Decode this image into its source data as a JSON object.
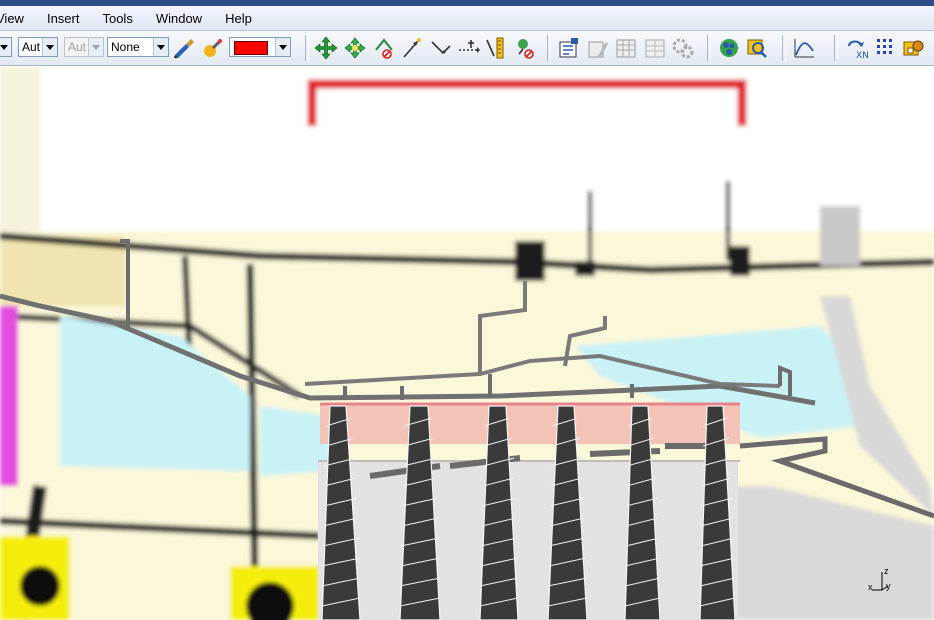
{
  "menubar": {
    "items": [
      {
        "label": "View",
        "name": "menu-view"
      },
      {
        "label": "Insert",
        "name": "menu-insert"
      },
      {
        "label": "Tools",
        "name": "menu-tools"
      },
      {
        "label": "Window",
        "name": "menu-window"
      },
      {
        "label": "Help",
        "name": "menu-help"
      }
    ]
  },
  "toolbar": {
    "combo_1": "Aut",
    "combo_2": "Aut",
    "combo_3": "None",
    "color_value": "#ff0000",
    "icons": [
      "paint-brush-icon",
      "highlight-brush-icon",
      "move-icon",
      "rotate-move-icon",
      "snap-point-icon",
      "line-arrow-icon",
      "angle-line-icon",
      "dimension-icon",
      "measure-icon",
      "delete-point-icon",
      "properties-icon",
      "edit-definition-icon",
      "table-icon",
      "table-disabled-icon",
      "gears-icon",
      "catalog-icon",
      "search-tree-icon",
      "curve-icon",
      "multi-axis-icon",
      "grid-points-icon",
      "parts-icon"
    ]
  },
  "viewport": {
    "axis_labels": {
      "x": "x",
      "y": "y",
      "z": "z"
    },
    "colors": {
      "background": "#fbf7d9",
      "fluid": "#c9f2f6",
      "frame": "#1a1a1a",
      "blade": "#3a3a3a",
      "highlight": "#e2202a"
    }
  }
}
